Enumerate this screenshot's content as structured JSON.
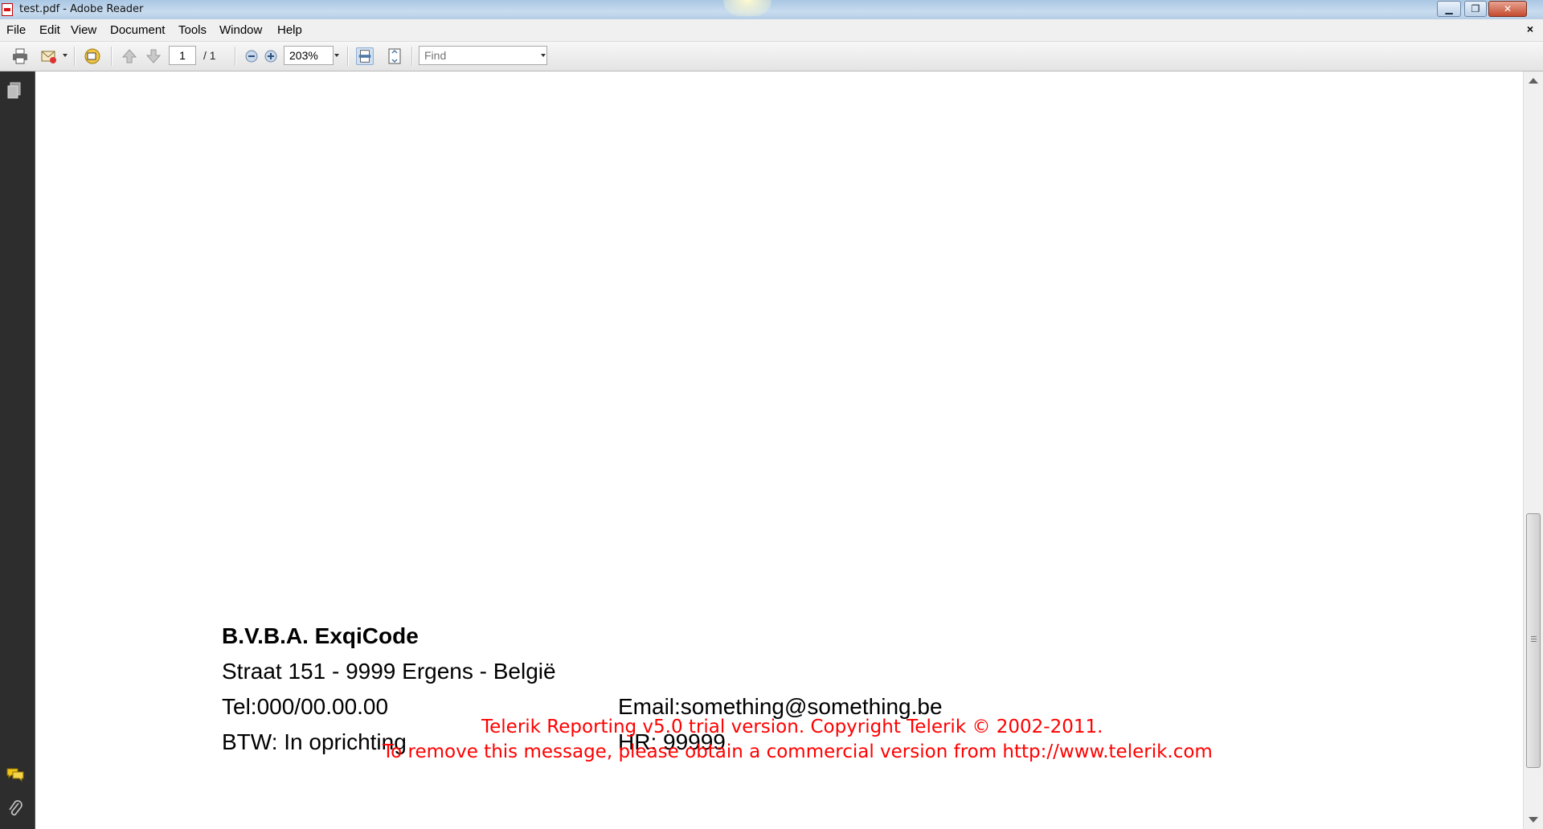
{
  "window": {
    "title": "test.pdf - Adobe Reader",
    "minimize_glyph": "▁",
    "maximize_glyph": "❐",
    "close_glyph": "✕"
  },
  "menubar": {
    "items": [
      {
        "label": "File"
      },
      {
        "label": "Edit"
      },
      {
        "label": "View"
      },
      {
        "label": "Document"
      },
      {
        "label": "Tools"
      },
      {
        "label": "Window"
      },
      {
        "label": "Help"
      }
    ],
    "doc_close_glyph": "×"
  },
  "toolbar": {
    "page_number": "1",
    "page_total": "/ 1",
    "zoom": "203%",
    "find_placeholder": "Find",
    "icons": [
      "print-icon",
      "email-icon",
      "collaborate-icon",
      "page-up-icon",
      "page-down-icon",
      "zoom-out-icon",
      "zoom-in-icon",
      "fit-width-icon",
      "fit-page-icon"
    ]
  },
  "leftnav": {
    "icons": [
      "pages-icon",
      "comments-icon",
      "attachments-icon"
    ]
  },
  "document": {
    "company": "B.V.B.A. ExqiCode",
    "address": "Straat 151 - 9999 Ergens - België",
    "tel": "Tel:000/00.00.00",
    "email": "Email:something@something.be",
    "btw": "BTW: In oprichting",
    "hr": "HR: 99999",
    "watermark_line1": "Telerik Reporting v5.0 trial version. Copyright Telerik © 2002-2011.",
    "watermark_line2": "To remove this message, please obtain a commercial version from http://www.telerik.com"
  },
  "colors": {
    "watermark": "#ff0000",
    "leftnav_bg": "#2d2d2d",
    "titlebar": "#b9d1ea"
  }
}
